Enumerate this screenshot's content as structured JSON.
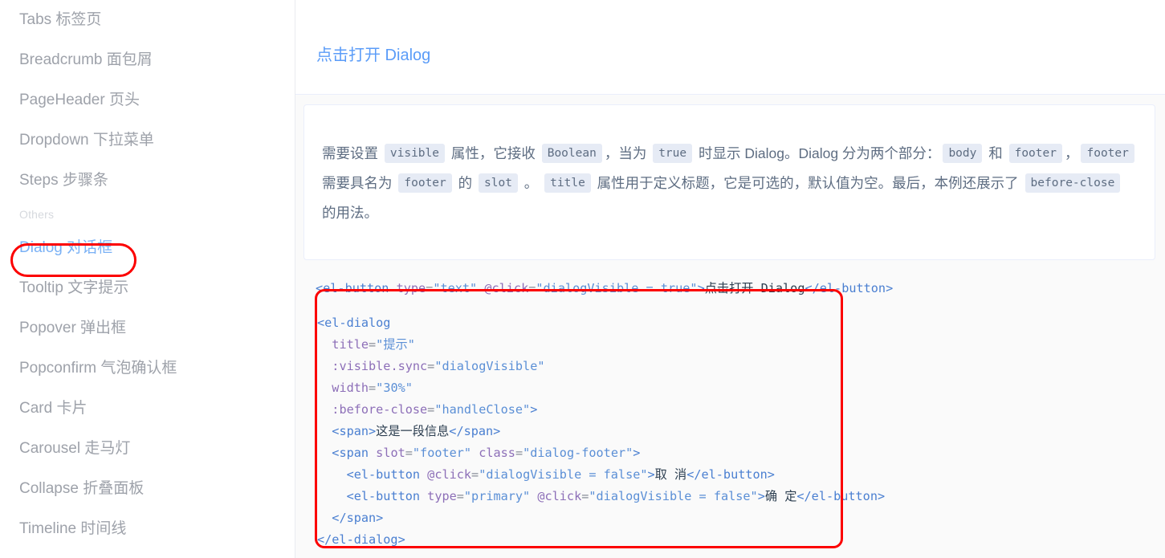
{
  "sidebar": {
    "items": [
      {
        "label": "Tabs 标签页",
        "active": false
      },
      {
        "label": "Breadcrumb 面包屑",
        "active": false
      },
      {
        "label": "PageHeader 页头",
        "active": false
      },
      {
        "label": "Dropdown 下拉菜单",
        "active": false
      },
      {
        "label": "Steps 步骤条",
        "active": false
      }
    ],
    "group_label": "Others",
    "group_items": [
      {
        "label": "Dialog 对话框",
        "active": true
      },
      {
        "label": "Tooltip 文字提示",
        "active": false
      },
      {
        "label": "Popover 弹出框",
        "active": false
      },
      {
        "label": "Popconfirm 气泡确认框",
        "active": false
      },
      {
        "label": "Card 卡片",
        "active": false
      },
      {
        "label": "Carousel 走马灯",
        "active": false
      },
      {
        "label": "Collapse 折叠面板",
        "active": false
      },
      {
        "label": "Timeline 时间线",
        "active": false
      }
    ]
  },
  "demo": {
    "open_dialog_button": "点击打开 Dialog"
  },
  "description": {
    "segments": [
      {
        "type": "text",
        "value": "需要设置 "
      },
      {
        "type": "code",
        "value": "visible"
      },
      {
        "type": "text",
        "value": " 属性，它接收 "
      },
      {
        "type": "code",
        "value": "Boolean"
      },
      {
        "type": "text",
        "value": "，当为 "
      },
      {
        "type": "code",
        "value": "true"
      },
      {
        "type": "text",
        "value": " 时显示 Dialog。Dialog 分为两个部分："
      },
      {
        "type": "code",
        "value": "body"
      },
      {
        "type": "text",
        "value": " 和 "
      },
      {
        "type": "code",
        "value": "footer"
      },
      {
        "type": "text",
        "value": "，"
      },
      {
        "type": "code",
        "value": "footer"
      },
      {
        "type": "text",
        "value": " 需要具名为 "
      },
      {
        "type": "code",
        "value": "footer"
      },
      {
        "type": "text",
        "value": " 的 "
      },
      {
        "type": "code",
        "value": "slot"
      },
      {
        "type": "text",
        "value": " 。 "
      },
      {
        "type": "code",
        "value": "title"
      },
      {
        "type": "text",
        "value": " 属性用于定义标题，它是可选的，默认值为空。最后，本例还展示了 "
      },
      {
        "type": "code",
        "value": "before-close"
      },
      {
        "type": "text",
        "value": " 的用法。"
      }
    ]
  },
  "code_button_line": {
    "full": "<el-button type=\"text\" @click=\"dialogVisible = true\">点击打开 Dialog</el-button>",
    "tokens": [
      {
        "t": "tag",
        "v": "<el-button"
      },
      {
        "t": "plain",
        "v": " "
      },
      {
        "t": "attr",
        "v": "type"
      },
      {
        "t": "eq",
        "v": "="
      },
      {
        "t": "str",
        "v": "\"text\""
      },
      {
        "t": "plain",
        "v": " "
      },
      {
        "t": "attr",
        "v": "@click"
      },
      {
        "t": "eq",
        "v": "="
      },
      {
        "t": "str",
        "v": "\"dialogVisible = true\""
      },
      {
        "t": "tag",
        "v": ">"
      },
      {
        "t": "txt",
        "v": "点击打开 Dialog"
      },
      {
        "t": "tag",
        "v": "</el-button>"
      }
    ]
  },
  "code_dialog_block": {
    "lines": [
      [
        {
          "t": "tag",
          "v": "<el-dialog"
        }
      ],
      [
        {
          "t": "plain",
          "v": "  "
        },
        {
          "t": "attr",
          "v": "title"
        },
        {
          "t": "eq",
          "v": "="
        },
        {
          "t": "str",
          "v": "\"提示\""
        }
      ],
      [
        {
          "t": "plain",
          "v": "  "
        },
        {
          "t": "attr",
          "v": ":visible.sync"
        },
        {
          "t": "eq",
          "v": "="
        },
        {
          "t": "str",
          "v": "\"dialogVisible\""
        }
      ],
      [
        {
          "t": "plain",
          "v": "  "
        },
        {
          "t": "attr",
          "v": "width"
        },
        {
          "t": "eq",
          "v": "="
        },
        {
          "t": "str",
          "v": "\"30%\""
        }
      ],
      [
        {
          "t": "plain",
          "v": "  "
        },
        {
          "t": "attr",
          "v": ":before-close"
        },
        {
          "t": "eq",
          "v": "="
        },
        {
          "t": "str",
          "v": "\"handleClose\""
        },
        {
          "t": "tag",
          "v": ">"
        }
      ],
      [
        {
          "t": "plain",
          "v": "  "
        },
        {
          "t": "tag",
          "v": "<span>"
        },
        {
          "t": "txt",
          "v": "这是一段信息"
        },
        {
          "t": "tag",
          "v": "</span>"
        }
      ],
      [
        {
          "t": "plain",
          "v": "  "
        },
        {
          "t": "tag",
          "v": "<span"
        },
        {
          "t": "plain",
          "v": " "
        },
        {
          "t": "attr",
          "v": "slot"
        },
        {
          "t": "eq",
          "v": "="
        },
        {
          "t": "str",
          "v": "\"footer\""
        },
        {
          "t": "plain",
          "v": " "
        },
        {
          "t": "attr",
          "v": "class"
        },
        {
          "t": "eq",
          "v": "="
        },
        {
          "t": "str",
          "v": "\"dialog-footer\""
        },
        {
          "t": "tag",
          "v": ">"
        }
      ],
      [
        {
          "t": "plain",
          "v": "    "
        },
        {
          "t": "tag",
          "v": "<el-button"
        },
        {
          "t": "plain",
          "v": " "
        },
        {
          "t": "attr",
          "v": "@click"
        },
        {
          "t": "eq",
          "v": "="
        },
        {
          "t": "str",
          "v": "\"dialogVisible = false\""
        },
        {
          "t": "tag",
          "v": ">"
        },
        {
          "t": "txt",
          "v": "取 消"
        },
        {
          "t": "tag",
          "v": "</el-button>"
        }
      ],
      [
        {
          "t": "plain",
          "v": "    "
        },
        {
          "t": "tag",
          "v": "<el-button"
        },
        {
          "t": "plain",
          "v": " "
        },
        {
          "t": "attr",
          "v": "type"
        },
        {
          "t": "eq",
          "v": "="
        },
        {
          "t": "str",
          "v": "\"primary\""
        },
        {
          "t": "plain",
          "v": " "
        },
        {
          "t": "attr",
          "v": "@click"
        },
        {
          "t": "eq",
          "v": "="
        },
        {
          "t": "str",
          "v": "\"dialogVisible = false\""
        },
        {
          "t": "tag",
          "v": ">"
        },
        {
          "t": "txt",
          "v": "确 定"
        },
        {
          "t": "tag",
          "v": "</el-button>"
        }
      ],
      [
        {
          "t": "plain",
          "v": "  "
        },
        {
          "t": "tag",
          "v": "</span>"
        }
      ],
      [
        {
          "t": "tag",
          "v": "</el-dialog>"
        }
      ]
    ]
  },
  "annotations": [
    {
      "name": "sidebar-dialog-highlight",
      "color": "#fc0000",
      "shape": "rounded-rect"
    },
    {
      "name": "code-block-highlight",
      "color": "#fc0000",
      "shape": "rounded-rect"
    }
  ],
  "colors": {
    "accent_link": "#5b9cf8",
    "sidebar_text": "#9ea2aa",
    "sidebar_active": "#7ab1f5",
    "annotation_red": "#fc0000",
    "chip_bg": "#e6ebf5",
    "code_bg": "#fafafa",
    "panel_border": "#eaeefb"
  }
}
